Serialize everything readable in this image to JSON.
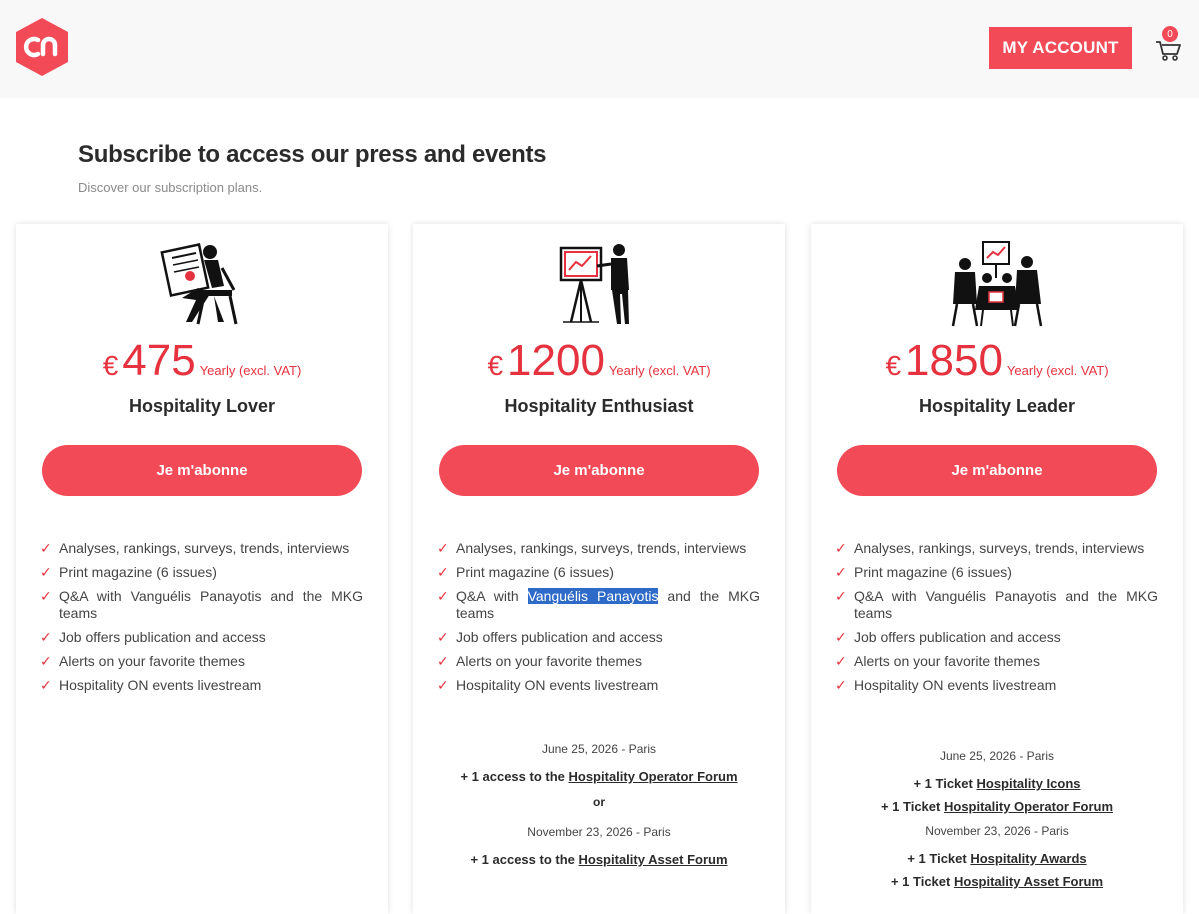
{
  "header": {
    "logo_text": "cn",
    "account_label": "MY ACCOUNT",
    "cart_count": "0"
  },
  "intro": {
    "title": "Subscribe to access our press and events",
    "subtitle": "Discover our subscription plans."
  },
  "colors": {
    "accent": "#f24b57",
    "price": "#e5323e",
    "selection": "#2e6ac7"
  },
  "plans": [
    {
      "currency": "€",
      "price": "475",
      "period": "Yearly (excl. VAT)",
      "name": "Hospitality Lover",
      "cta": "Je m'abonne",
      "features": [
        "Analyses, rankings, surveys, trends, interviews",
        "Print magazine (6 issues)",
        "Q&A with Vanguélis Panayotis and the MKG teams",
        "Job offers publication and access",
        "Alerts on your favorite themes",
        "Hospitality ON events livestream"
      ]
    },
    {
      "currency": "€",
      "price": "1200",
      "period": "Yearly (excl. VAT)",
      "name": "Hospitality Enthusiast",
      "cta": "Je m'abonne",
      "features": [
        "Analyses, rankings, surveys, trends, interviews",
        "Print magazine (6 issues)",
        "Q&A with",
        "Vanguélis Panayotis",
        "and the MKG teams",
        "Job offers publication and access",
        "Alerts on your favorite themes",
        "Hospitality ON events livestream"
      ],
      "events": {
        "date1": "June 25, 2026 - Paris",
        "prefix1": "+ 1 access to the",
        "link1": "Hospitality Operator Forum",
        "or": "or",
        "date2": "November 23, 2026 - Paris",
        "prefix2": "+ 1 access to the",
        "link2": "Hospitality Asset Forum"
      }
    },
    {
      "currency": "€",
      "price": "1850",
      "period": "Yearly (excl. VAT)",
      "name": "Hospitality Leader",
      "cta": "Je m'abonne",
      "features": [
        "Analyses, rankings, surveys, trends, interviews",
        "Print magazine (6 issues)",
        "Q&A with Vanguélis Panayotis and the MKG teams",
        "Job offers publication and access",
        "Alerts on your favorite themes",
        "Hospitality ON events livestream"
      ],
      "events": {
        "date1": "June 25, 2026 - Paris",
        "ticket_prefix": "+ 1 Ticket",
        "link1a": "Hospitality Icons",
        "link1b": "Hospitality Operator Forum",
        "date2": "November 23, 2026 - Paris",
        "link2a": "Hospitality Awards",
        "link2b": "Hospitality Asset Forum"
      }
    }
  ]
}
